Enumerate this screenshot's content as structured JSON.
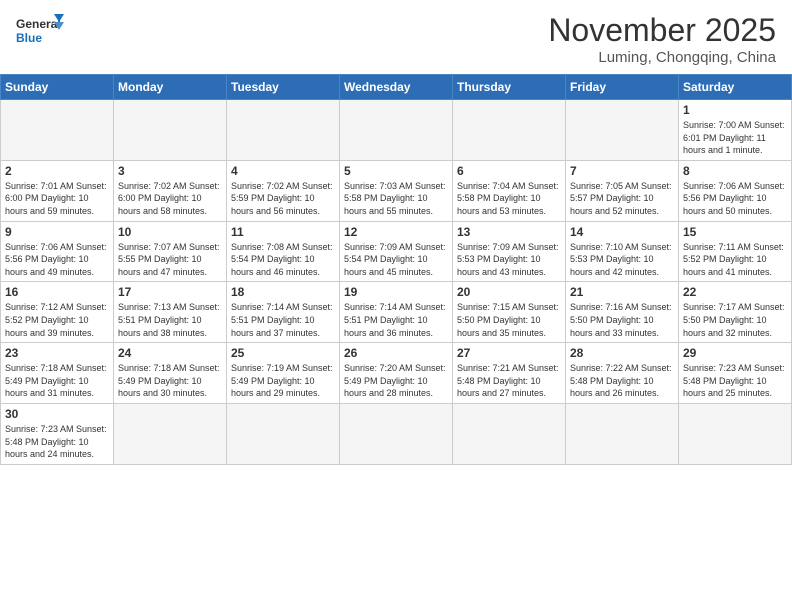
{
  "logo": {
    "general": "General",
    "blue": "Blue"
  },
  "title": "November 2025",
  "location": "Luming, Chongqing, China",
  "weekdays": [
    "Sunday",
    "Monday",
    "Tuesday",
    "Wednesday",
    "Thursday",
    "Friday",
    "Saturday"
  ],
  "weeks": [
    [
      {
        "day": "",
        "info": ""
      },
      {
        "day": "",
        "info": ""
      },
      {
        "day": "",
        "info": ""
      },
      {
        "day": "",
        "info": ""
      },
      {
        "day": "",
        "info": ""
      },
      {
        "day": "",
        "info": ""
      },
      {
        "day": "1",
        "info": "Sunrise: 7:00 AM\nSunset: 6:01 PM\nDaylight: 11 hours and 1 minute."
      }
    ],
    [
      {
        "day": "2",
        "info": "Sunrise: 7:01 AM\nSunset: 6:00 PM\nDaylight: 10 hours and 59 minutes."
      },
      {
        "day": "3",
        "info": "Sunrise: 7:02 AM\nSunset: 6:00 PM\nDaylight: 10 hours and 58 minutes."
      },
      {
        "day": "4",
        "info": "Sunrise: 7:02 AM\nSunset: 5:59 PM\nDaylight: 10 hours and 56 minutes."
      },
      {
        "day": "5",
        "info": "Sunrise: 7:03 AM\nSunset: 5:58 PM\nDaylight: 10 hours and 55 minutes."
      },
      {
        "day": "6",
        "info": "Sunrise: 7:04 AM\nSunset: 5:58 PM\nDaylight: 10 hours and 53 minutes."
      },
      {
        "day": "7",
        "info": "Sunrise: 7:05 AM\nSunset: 5:57 PM\nDaylight: 10 hours and 52 minutes."
      },
      {
        "day": "8",
        "info": "Sunrise: 7:06 AM\nSunset: 5:56 PM\nDaylight: 10 hours and 50 minutes."
      }
    ],
    [
      {
        "day": "9",
        "info": "Sunrise: 7:06 AM\nSunset: 5:56 PM\nDaylight: 10 hours and 49 minutes."
      },
      {
        "day": "10",
        "info": "Sunrise: 7:07 AM\nSunset: 5:55 PM\nDaylight: 10 hours and 47 minutes."
      },
      {
        "day": "11",
        "info": "Sunrise: 7:08 AM\nSunset: 5:54 PM\nDaylight: 10 hours and 46 minutes."
      },
      {
        "day": "12",
        "info": "Sunrise: 7:09 AM\nSunset: 5:54 PM\nDaylight: 10 hours and 45 minutes."
      },
      {
        "day": "13",
        "info": "Sunrise: 7:09 AM\nSunset: 5:53 PM\nDaylight: 10 hours and 43 minutes."
      },
      {
        "day": "14",
        "info": "Sunrise: 7:10 AM\nSunset: 5:53 PM\nDaylight: 10 hours and 42 minutes."
      },
      {
        "day": "15",
        "info": "Sunrise: 7:11 AM\nSunset: 5:52 PM\nDaylight: 10 hours and 41 minutes."
      }
    ],
    [
      {
        "day": "16",
        "info": "Sunrise: 7:12 AM\nSunset: 5:52 PM\nDaylight: 10 hours and 39 minutes."
      },
      {
        "day": "17",
        "info": "Sunrise: 7:13 AM\nSunset: 5:51 PM\nDaylight: 10 hours and 38 minutes."
      },
      {
        "day": "18",
        "info": "Sunrise: 7:14 AM\nSunset: 5:51 PM\nDaylight: 10 hours and 37 minutes."
      },
      {
        "day": "19",
        "info": "Sunrise: 7:14 AM\nSunset: 5:51 PM\nDaylight: 10 hours and 36 minutes."
      },
      {
        "day": "20",
        "info": "Sunrise: 7:15 AM\nSunset: 5:50 PM\nDaylight: 10 hours and 35 minutes."
      },
      {
        "day": "21",
        "info": "Sunrise: 7:16 AM\nSunset: 5:50 PM\nDaylight: 10 hours and 33 minutes."
      },
      {
        "day": "22",
        "info": "Sunrise: 7:17 AM\nSunset: 5:50 PM\nDaylight: 10 hours and 32 minutes."
      }
    ],
    [
      {
        "day": "23",
        "info": "Sunrise: 7:18 AM\nSunset: 5:49 PM\nDaylight: 10 hours and 31 minutes."
      },
      {
        "day": "24",
        "info": "Sunrise: 7:18 AM\nSunset: 5:49 PM\nDaylight: 10 hours and 30 minutes."
      },
      {
        "day": "25",
        "info": "Sunrise: 7:19 AM\nSunset: 5:49 PM\nDaylight: 10 hours and 29 minutes."
      },
      {
        "day": "26",
        "info": "Sunrise: 7:20 AM\nSunset: 5:49 PM\nDaylight: 10 hours and 28 minutes."
      },
      {
        "day": "27",
        "info": "Sunrise: 7:21 AM\nSunset: 5:48 PM\nDaylight: 10 hours and 27 minutes."
      },
      {
        "day": "28",
        "info": "Sunrise: 7:22 AM\nSunset: 5:48 PM\nDaylight: 10 hours and 26 minutes."
      },
      {
        "day": "29",
        "info": "Sunrise: 7:23 AM\nSunset: 5:48 PM\nDaylight: 10 hours and 25 minutes."
      }
    ],
    [
      {
        "day": "30",
        "info": "Sunrise: 7:23 AM\nSunset: 5:48 PM\nDaylight: 10 hours and 24 minutes."
      },
      {
        "day": "",
        "info": ""
      },
      {
        "day": "",
        "info": ""
      },
      {
        "day": "",
        "info": ""
      },
      {
        "day": "",
        "info": ""
      },
      {
        "day": "",
        "info": ""
      },
      {
        "day": "",
        "info": ""
      }
    ]
  ]
}
